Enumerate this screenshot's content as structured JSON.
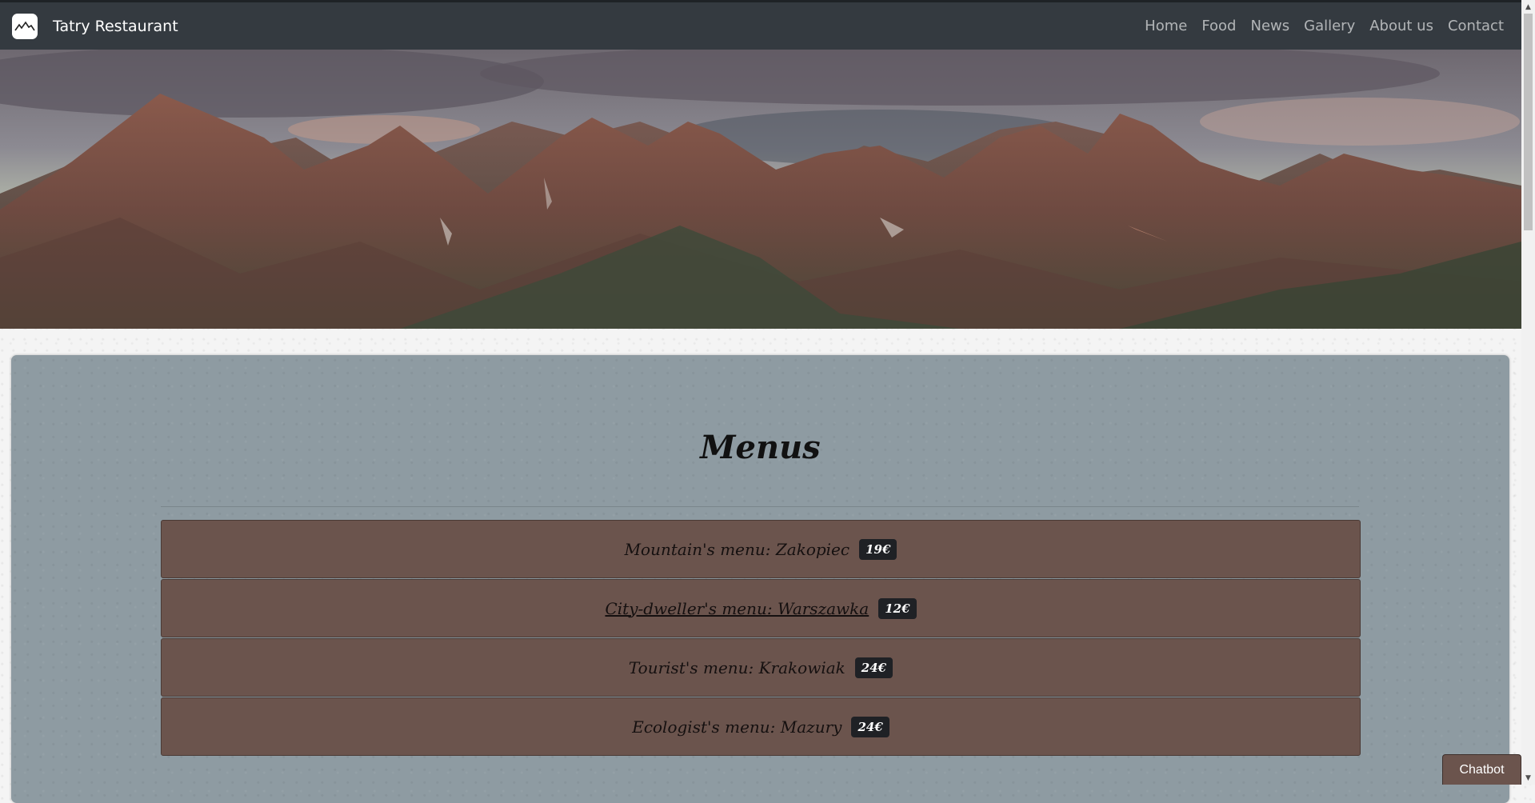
{
  "navbar": {
    "brand_name": "Tatry Restaurant",
    "links": [
      "Home",
      "Food",
      "News",
      "Gallery",
      "About us",
      "Contact"
    ]
  },
  "hero": {
    "icon": "mountain-logo-icon"
  },
  "menus": {
    "title": "Menus",
    "items": [
      {
        "name": "Mountain's menu: Zakopiec",
        "price": "19€"
      },
      {
        "name": "City-dweller's menu: Warszawka",
        "price": "12€"
      },
      {
        "name": "Tourist's menu: Krakowiak",
        "price": "24€"
      },
      {
        "name": "Ecologist's menu: Mazury",
        "price": "24€"
      }
    ]
  },
  "chatbot": {
    "label": "Chatbot"
  },
  "colors": {
    "navbar": "#343a40",
    "menu_card": "#8e9ba2",
    "menu_item": "#6b544d",
    "price_badge": "#1f2125"
  }
}
